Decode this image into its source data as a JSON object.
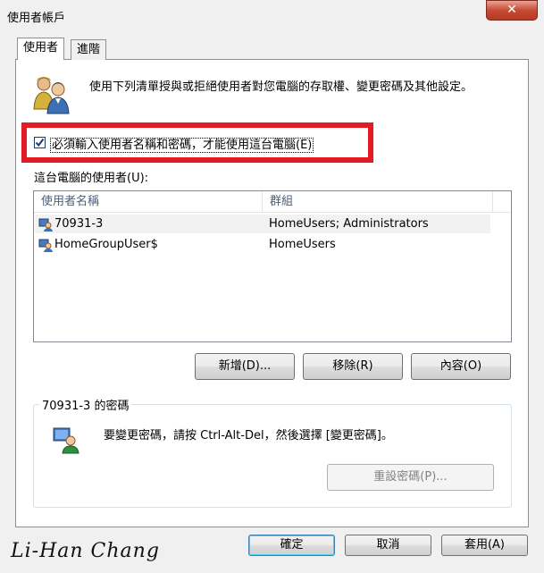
{
  "window": {
    "title": "使用者帳戶",
    "close_label": "✕"
  },
  "tabs": [
    {
      "label": "使用者",
      "active": true
    },
    {
      "label": "進階",
      "active": false
    }
  ],
  "intro": {
    "text": "使用下列清單授與或拒絕使用者對您電腦的存取權、變更密碼及其他設定。",
    "icon": "users-icon"
  },
  "require_password": {
    "checked": true,
    "label": "必須輸入使用者名稱和密碼，才能使用這台電腦",
    "accel": "(E)"
  },
  "users_label": "這台電腦的使用者(U):",
  "user_list": {
    "columns": [
      "使用者名稱",
      "群組"
    ],
    "rows": [
      {
        "name": "70931-3",
        "group": "HomeUsers; Administrators"
      },
      {
        "name": "HomeGroupUser$",
        "group": "HomeUsers"
      }
    ]
  },
  "list_buttons": {
    "add": "新增(D)...",
    "remove": "移除(R)",
    "properties": "內容(O)"
  },
  "password_group": {
    "legend": "70931-3 的密碼",
    "text": "要變更密碼，請按 Ctrl-Alt-Del，然後選擇 [變更密碼]。",
    "reset_button": "重設密碼(P)..."
  },
  "dialog_buttons": {
    "ok": "確定",
    "cancel": "取消",
    "apply": "套用(A)"
  },
  "signature": "Li-Han Chang",
  "colors": {
    "highlight_box": "#e31b23",
    "list_header_text": "#4c607a"
  }
}
